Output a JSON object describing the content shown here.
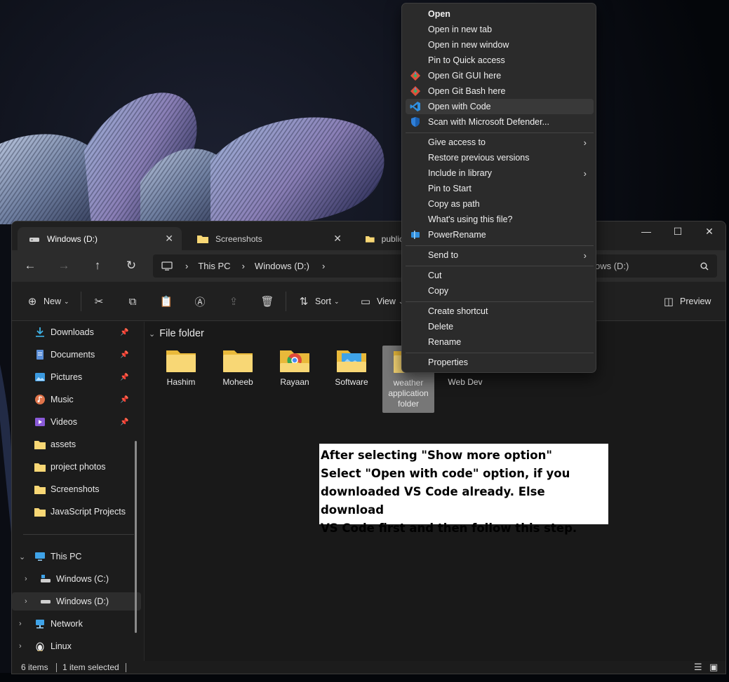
{
  "tabs": [
    {
      "label": "Windows (D:)",
      "icon": "drive-icon",
      "active": true
    },
    {
      "label": "Screenshots",
      "icon": "folder-icon",
      "active": false
    },
    {
      "label": "public",
      "icon": "folder-icon",
      "active": false
    }
  ],
  "address": {
    "segments": [
      "This PC",
      "Windows (D:)"
    ],
    "search_partial": "ows (D:)"
  },
  "toolbar": {
    "new_label": "New",
    "sort_label": "Sort",
    "view_label": "View",
    "preview_label": "Preview"
  },
  "sidebar": {
    "quick_access": [
      {
        "label": "Downloads",
        "icon": "download-icon",
        "pinned": true
      },
      {
        "label": "Documents",
        "icon": "document-icon",
        "pinned": true
      },
      {
        "label": "Pictures",
        "icon": "picture-icon",
        "pinned": true
      },
      {
        "label": "Music",
        "icon": "music-icon",
        "pinned": true
      },
      {
        "label": "Videos",
        "icon": "video-icon",
        "pinned": true
      },
      {
        "label": "assets",
        "icon": "folder-icon",
        "pinned": false
      },
      {
        "label": "project photos",
        "icon": "folder-icon",
        "pinned": false
      },
      {
        "label": "Screenshots",
        "icon": "folder-icon",
        "pinned": false
      },
      {
        "label": "JavaScript Projects",
        "icon": "folder-icon",
        "pinned": false
      }
    ],
    "this_pc": {
      "label": "This PC",
      "children": [
        {
          "label": "Windows (C:)",
          "icon": "system-drive-icon"
        },
        {
          "label": "Windows (D:)",
          "icon": "drive-icon",
          "selected": true
        }
      ]
    },
    "network": "Network",
    "linux": "Linux"
  },
  "content": {
    "group_label": "File folder",
    "folders": [
      {
        "name": "Hashim",
        "variant": "plain"
      },
      {
        "name": "Moheeb",
        "variant": "plain"
      },
      {
        "name": "Rayaan",
        "variant": "chrome"
      },
      {
        "name": "Software",
        "variant": "image"
      },
      {
        "name": "weather application folder",
        "variant": "plain",
        "selected": true
      },
      {
        "name": "Web Dev",
        "variant": "plain"
      }
    ]
  },
  "status": {
    "items": "6 items",
    "selected": "1 item selected"
  },
  "context_menu": {
    "group1": [
      {
        "label": "Open",
        "bold": true
      },
      {
        "label": "Open in new tab"
      },
      {
        "label": "Open in new window"
      },
      {
        "label": "Pin to Quick access"
      },
      {
        "label": "Open Git GUI here",
        "icon": "git-icon"
      },
      {
        "label": "Open Git Bash here",
        "icon": "git-icon"
      },
      {
        "label": "Open with Code",
        "icon": "vscode-icon",
        "hover": true
      },
      {
        "label": "Scan with Microsoft Defender...",
        "icon": "defender-icon"
      }
    ],
    "group2": [
      {
        "label": "Give access to",
        "submenu": true
      },
      {
        "label": "Restore previous versions"
      },
      {
        "label": "Include in library",
        "submenu": true
      },
      {
        "label": "Pin to Start"
      },
      {
        "label": "Copy as path"
      },
      {
        "label": "What's using this file?"
      },
      {
        "label": "PowerRename",
        "icon": "powerrename-icon"
      }
    ],
    "group3": [
      {
        "label": "Send to",
        "submenu": true
      }
    ],
    "group4": [
      {
        "label": "Cut"
      },
      {
        "label": "Copy"
      }
    ],
    "group5": [
      {
        "label": "Create shortcut"
      },
      {
        "label": "Delete"
      },
      {
        "label": "Rename"
      }
    ],
    "group6": [
      {
        "label": "Properties"
      }
    ]
  },
  "note": {
    "line1": "After selecting \"Show more option\"",
    "line2": "Select \"Open with code\" option, if you",
    "line3": "downloaded VS Code already. Else download",
    "line4": "VS Code first and then follow this step."
  },
  "colors": {
    "folder_yellow": "#f8d775",
    "accent_vscode": "#2f8fe0",
    "menu_bg": "#2b2b2b"
  }
}
